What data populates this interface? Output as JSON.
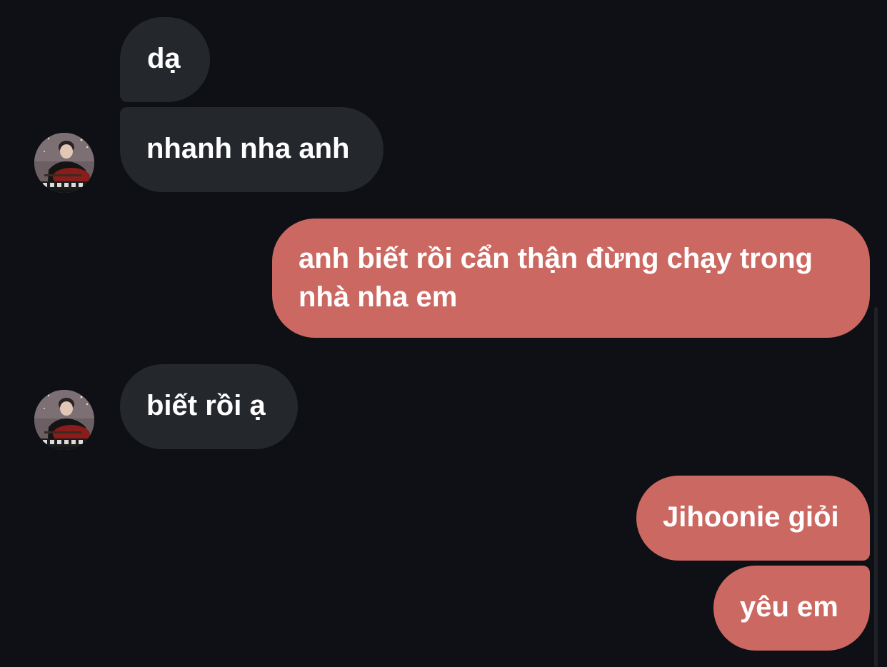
{
  "conversation": {
    "messages": [
      {
        "sender": "contact",
        "text": "dạ"
      },
      {
        "sender": "contact",
        "text": "nhanh nha anh"
      },
      {
        "sender": "me",
        "text": "anh biết rồi cẩn thận đừng chạy trong nhà nha em"
      },
      {
        "sender": "contact",
        "text": "biết rồi ạ"
      },
      {
        "sender": "me",
        "text": "Jihoonie giỏi"
      },
      {
        "sender": "me",
        "text": "yêu em"
      }
    ]
  },
  "colors": {
    "background": "#0e1015",
    "incoming_bubble": "#24272c",
    "outgoing_bubble": "#cc6862",
    "text": "#ffffff"
  },
  "icons": {
    "contact_avatar": "avatar-photo"
  }
}
